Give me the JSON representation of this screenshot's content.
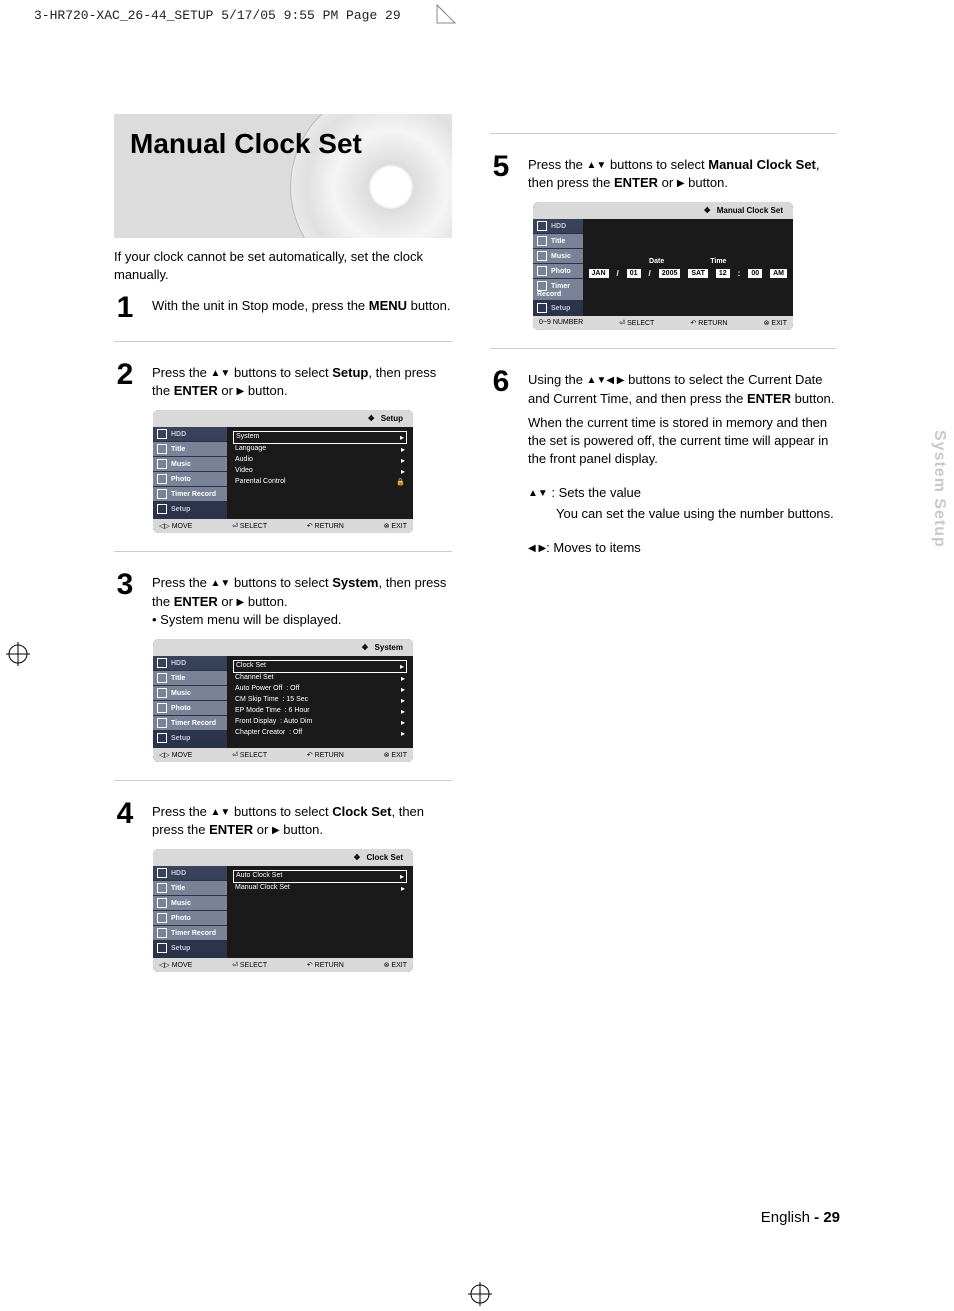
{
  "header": {
    "crop": "3-HR720-XAC_26-44_SETUP   5/17/05   9:55 PM   Page 29"
  },
  "title": "Manual Clock Set",
  "intro": "If your clock cannot be set automatically, set the clock manually.",
  "steps": {
    "s1": {
      "num": "1",
      "pre": "With the unit in Stop mode, press the ",
      "b1": "MENU",
      "post": " button."
    },
    "s2": {
      "num": "2",
      "pre": "Press the ",
      "arrows": "▲▼",
      "mid": " buttons to select ",
      "b1": "Setup",
      "post1": ", then press the ",
      "b2": "ENTER",
      "post2": " or ",
      "playarr": "▶",
      "post3": " button."
    },
    "s3": {
      "num": "3",
      "pre": "Press the ",
      "arrows": "▲▼",
      "mid": " buttons to select ",
      "b1": "System",
      "post1": ", then press the ",
      "b2": "ENTER",
      "post2": " or ",
      "playarr": "▶",
      "post3": " button.",
      "bullet": "System menu will be displayed."
    },
    "s4": {
      "num": "4",
      "pre": "Press the ",
      "arrows": "▲▼",
      "mid": " buttons to select ",
      "b1": "Clock Set",
      "post1": ", then press the ",
      "b2": "ENTER",
      "post2": " or ",
      "playarr": "▶",
      "post3": " button."
    },
    "s5": {
      "num": "5",
      "pre": "Press the ",
      "arrows": "▲▼",
      "mid": " buttons to select ",
      "b1": "Manual Clock Set",
      "post1": ", then press the ",
      "b2": "ENTER",
      "post2": " or ",
      "playarr": "▶",
      "post3": " button."
    },
    "s6": {
      "num": "6",
      "pre": "Using the ",
      "arrows": "▲▼◀ ▶",
      "mid": " buttons to select the Current Date and Current Time, and then press the ",
      "b1": "ENTER",
      "post": " button.",
      "line2": "When the current time is stored in memory and then the set is powered off, the current time will appear in the front panel display.",
      "sub1_sym": "▲▼",
      "sub1": " : Sets the value",
      "sub1b": "You can set the value using the number buttons.",
      "sub2_sym": "◀ ▶",
      "sub2": ": Moves to items"
    }
  },
  "osd": {
    "side": {
      "hdd": "HDD",
      "title": "Title",
      "music": "Music",
      "photo": "Photo",
      "timer": "Timer Record",
      "setup": "Setup"
    },
    "setup": {
      "hdr": "Setup",
      "items": [
        "System",
        "Language",
        "Audio",
        "Video"
      ],
      "pc": "Parental Control"
    },
    "system": {
      "hdr": "System",
      "items": [
        {
          "l": "Clock Set",
          "r": ""
        },
        {
          "l": "Channel Set",
          "r": ""
        },
        {
          "l": "Auto Power Off",
          "r": ": Off"
        },
        {
          "l": "CM Skip Time",
          "r": ": 15 Sec"
        },
        {
          "l": "EP Mode Time",
          "r": ": 6 Hour"
        },
        {
          "l": "Front Display",
          "r": ": Auto Dim"
        },
        {
          "l": "Chapter Creator",
          "r": ": Off"
        }
      ]
    },
    "clockset": {
      "hdr": "Clock Set",
      "items": [
        "Auto Clock Set",
        "Manual Clock Set"
      ]
    },
    "manual": {
      "hdr": "Manual Clock Set",
      "date_lbl": "Date",
      "time_lbl": "Time",
      "jan": "JAN",
      "d": "01",
      "y": "2005",
      "sat": "SAT",
      "h": "12",
      "m": "00",
      "ampm": "AM"
    },
    "ftr": {
      "move": "◁▷ MOVE",
      "select": "⏎ SELECT",
      "return": "↶ RETURN",
      "exit": "⊗ EXIT",
      "number": "0~9 NUMBER"
    }
  },
  "sidetab": "System Setup",
  "footer": {
    "lang": "English",
    "dash": " - ",
    "page": "29"
  }
}
